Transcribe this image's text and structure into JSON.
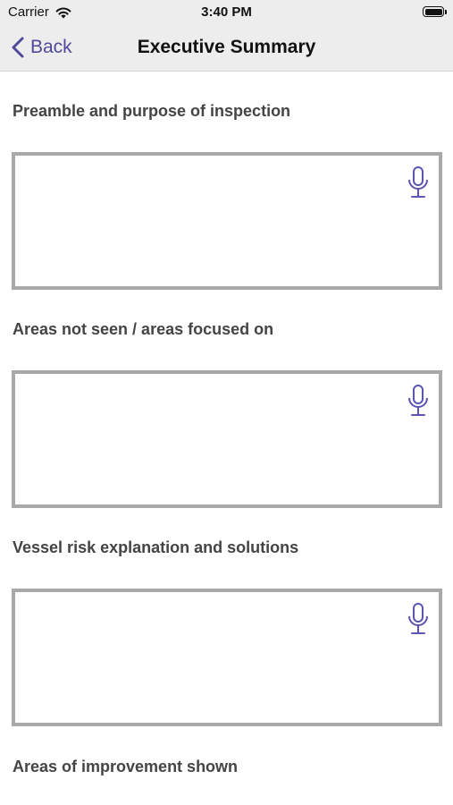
{
  "status_bar": {
    "carrier": "Carrier",
    "time": "3:40 PM"
  },
  "nav": {
    "back_label": "Back",
    "title": "Executive Summary"
  },
  "colors": {
    "accent": "#4f4a9c",
    "box_border": "#a8a8a8",
    "label_text": "#444444"
  },
  "sections": [
    {
      "label": "Preamble and purpose of inspection",
      "value": "",
      "icon": "microphone-icon"
    },
    {
      "label": "Areas not seen / areas focused on",
      "value": "",
      "icon": "microphone-icon"
    },
    {
      "label": "Vessel risk explanation and solutions",
      "value": "",
      "icon": "microphone-icon"
    },
    {
      "label": "Areas of improvement shown"
    }
  ]
}
